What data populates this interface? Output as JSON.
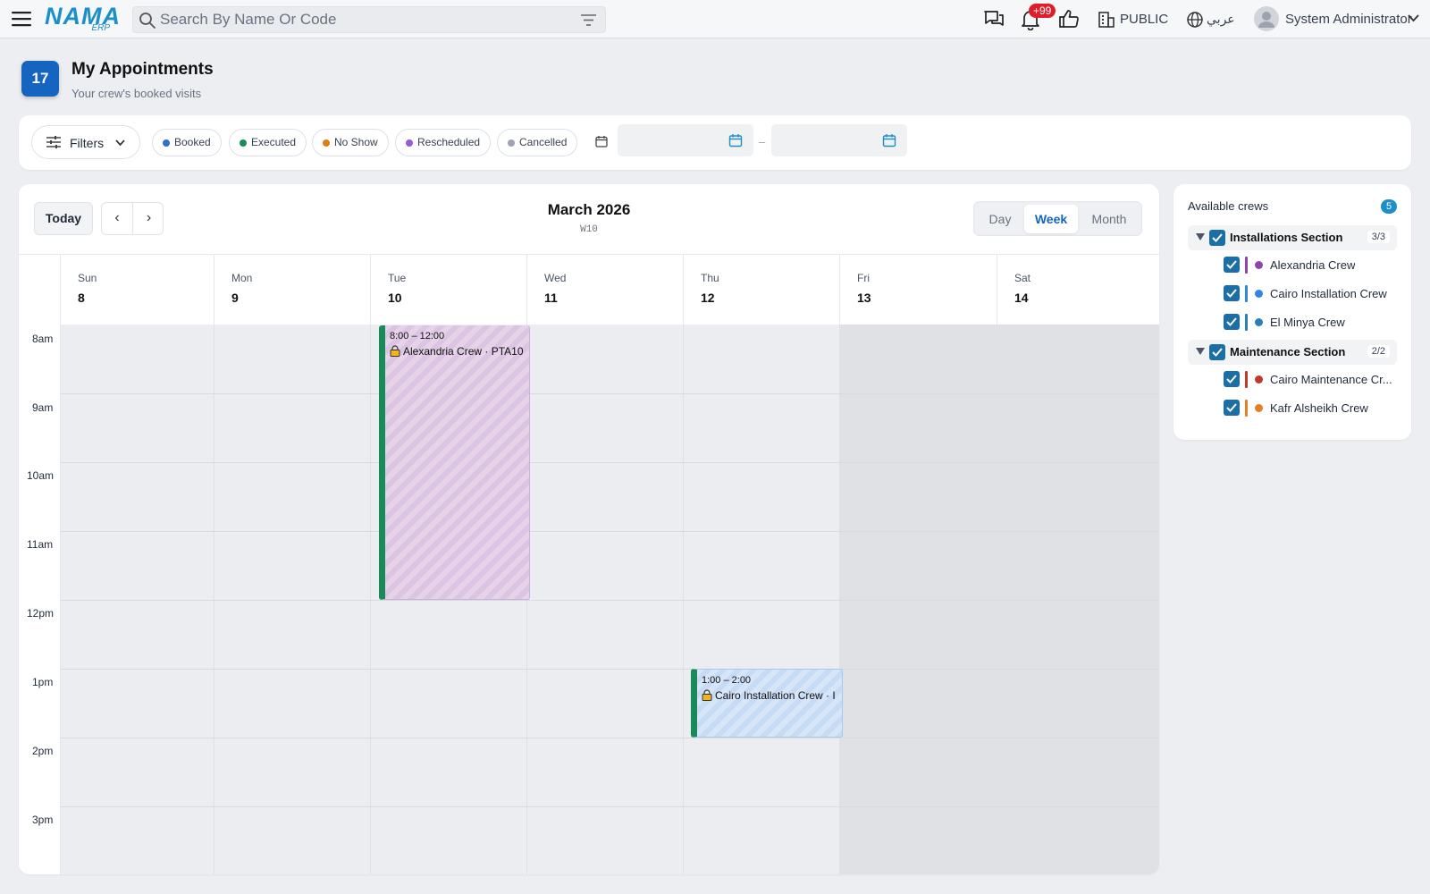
{
  "topbar": {
    "logo_main": "NAMA",
    "logo_sub": "ERP",
    "search_placeholder": "Search By Name Or Code",
    "notification_count": "+99",
    "branch": "PUBLIC",
    "language": "عربي",
    "user_name": "System Administrator"
  },
  "header": {
    "date_badge": "17",
    "title": "My Appointments",
    "subtitle": "Your crew's booked visits"
  },
  "filters": {
    "button_label": "Filters",
    "statuses": [
      {
        "label": "Booked",
        "color": "#2f6fd1"
      },
      {
        "label": "Executed",
        "color": "#1b8a5a"
      },
      {
        "label": "No Show",
        "color": "#e07d10"
      },
      {
        "label": "Rescheduled",
        "color": "#9b59d6"
      },
      {
        "label": "Cancelled",
        "color": "#9ca3af"
      }
    ],
    "date_from": "",
    "date_to": "",
    "date_separator": "–"
  },
  "calendar": {
    "today_label": "Today",
    "prev_label": "‹",
    "next_label": "›",
    "month_title": "March 2026",
    "week_label": "W10",
    "views": [
      "Day",
      "Week",
      "Month"
    ],
    "active_view": "Week",
    "days": [
      {
        "name": "Sun",
        "date": "8"
      },
      {
        "name": "Mon",
        "date": "9"
      },
      {
        "name": "Tue",
        "date": "10"
      },
      {
        "name": "Wed",
        "date": "11"
      },
      {
        "name": "Thu",
        "date": "12"
      },
      {
        "name": "Fri",
        "date": "13"
      },
      {
        "name": "Sat",
        "date": "14"
      }
    ],
    "hours": [
      "8am",
      "9am",
      "10am",
      "11am",
      "12pm",
      "1pm",
      "2pm",
      "3pm"
    ],
    "events": [
      {
        "time": "8:00 – 12:00",
        "title": "Alexandria Crew · PTA10",
        "status_color": "#1b8a5a"
      },
      {
        "time": "1:00 – 2:00",
        "title": "Cairo Installation Crew · I",
        "status_color": "#1b8a5a"
      }
    ]
  },
  "crews": {
    "title": "Available crews",
    "count": "5",
    "sections": [
      {
        "label": "Installations Section",
        "count": "3/3",
        "crews": [
          {
            "label": "Alexandria Crew",
            "color": "#8e44ad"
          },
          {
            "label": "Cairo Installation Crew",
            "color": "#2e86de"
          },
          {
            "label": "El Minya Crew",
            "color": "#2a7fb8"
          }
        ]
      },
      {
        "label": "Maintenance Section",
        "count": "2/2",
        "crews": [
          {
            "label": "Cairo Maintenance Cr...",
            "color": "#c0392b"
          },
          {
            "label": "Kafr Alsheikh Crew",
            "color": "#e67e22"
          }
        ]
      }
    ]
  }
}
